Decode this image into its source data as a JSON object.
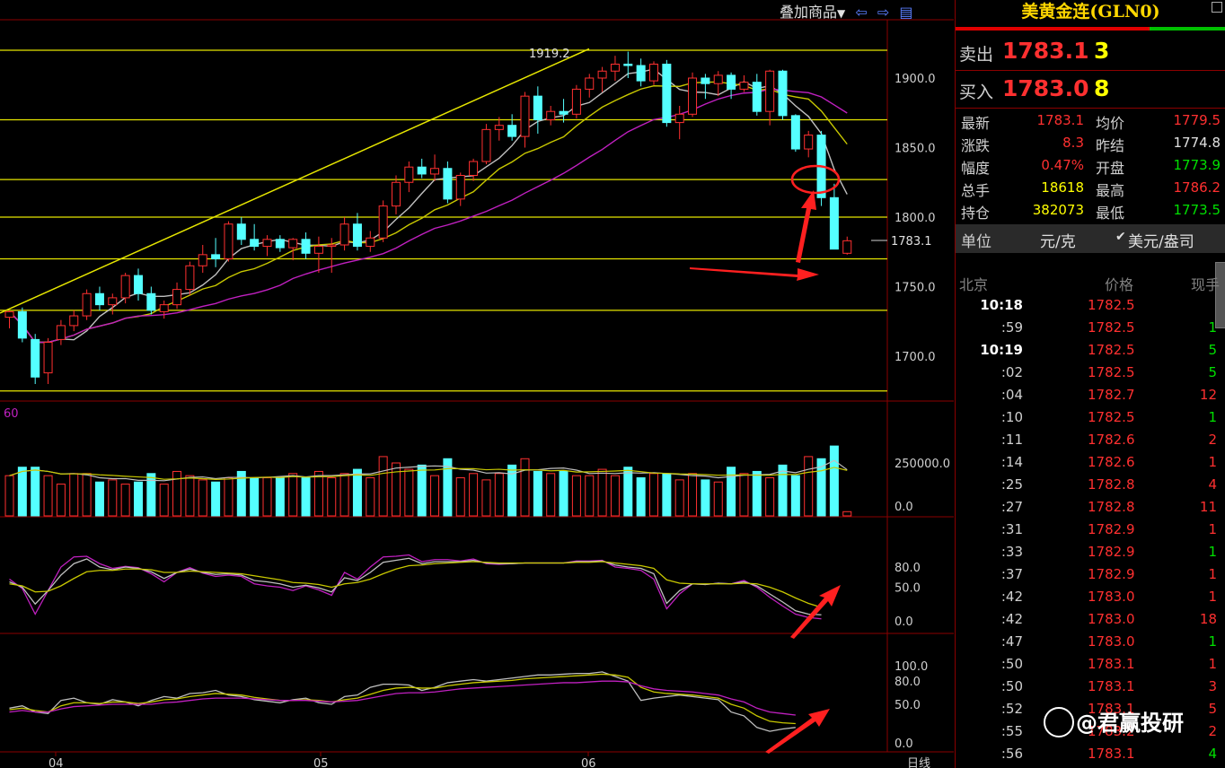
{
  "toolbar": {
    "overlay_label": "叠加商品",
    "dropdown_icon": "caret-down-icon",
    "prev_icon": "arrow-left-icon",
    "next_icon": "arrow-right-icon",
    "layout_icon": "layout-icon"
  },
  "panel": {
    "title": "美黄金连(GLN0)",
    "sell": {
      "label": "卖出",
      "price": "1783.1",
      "volume": "3"
    },
    "buy": {
      "label": "买入",
      "price": "1783.0",
      "volume": "8"
    },
    "stats": [
      {
        "k1": "最新",
        "v1": "1783.1",
        "c1": "#ff3030",
        "k2": "均价",
        "v2": "1779.5",
        "c2": "#ff3030"
      },
      {
        "k1": "涨跌",
        "v1": "8.3",
        "c1": "#ff3030",
        "k2": "昨结",
        "v2": "1774.8",
        "c2": "#e0e0e0"
      },
      {
        "k1": "幅度",
        "v1": "0.47%",
        "c1": "#ff3030",
        "k2": "开盘",
        "v2": "1773.9",
        "c2": "#00e000"
      },
      {
        "k1": "总手",
        "v1": "18618",
        "c1": "#ffff00",
        "k2": "最高",
        "v2": "1786.2",
        "c2": "#ff3030"
      },
      {
        "k1": "持仓",
        "v1": "382073",
        "c1": "#ffff00",
        "k2": "最低",
        "v2": "1773.5",
        "c2": "#00e000"
      }
    ],
    "unit_label": "单位",
    "unit_option1": "元/克",
    "unit_option2": "美元/盎司",
    "ticks_header": {
      "c1": "北京",
      "c2": "价格",
      "c3": "现手"
    },
    "ticks": [
      {
        "t": "10:18",
        "bold": true,
        "p": "1782.5",
        "v": "",
        "vc": "#00e000"
      },
      {
        "t": ":59",
        "bold": false,
        "p": "1782.5",
        "v": "1",
        "vc": "#00e000"
      },
      {
        "t": "10:19",
        "bold": true,
        "p": "1782.5",
        "v": "5",
        "vc": "#00e000"
      },
      {
        "t": ":02",
        "bold": false,
        "p": "1782.5",
        "v": "5",
        "vc": "#00e000"
      },
      {
        "t": ":04",
        "bold": false,
        "p": "1782.7",
        "v": "12",
        "vc": "#ff3030"
      },
      {
        "t": ":10",
        "bold": false,
        "p": "1782.5",
        "v": "1",
        "vc": "#00e000"
      },
      {
        "t": ":11",
        "bold": false,
        "p": "1782.6",
        "v": "2",
        "vc": "#ff3030"
      },
      {
        "t": ":14",
        "bold": false,
        "p": "1782.6",
        "v": "1",
        "vc": "#ff3030"
      },
      {
        "t": ":25",
        "bold": false,
        "p": "1782.8",
        "v": "4",
        "vc": "#ff3030"
      },
      {
        "t": ":27",
        "bold": false,
        "p": "1782.8",
        "v": "11",
        "vc": "#ff3030"
      },
      {
        "t": ":31",
        "bold": false,
        "p": "1782.9",
        "v": "1",
        "vc": "#ff3030"
      },
      {
        "t": ":33",
        "bold": false,
        "p": "1782.9",
        "v": "1",
        "vc": "#00e000"
      },
      {
        "t": ":37",
        "bold": false,
        "p": "1782.9",
        "v": "1",
        "vc": "#ff3030"
      },
      {
        "t": ":42",
        "bold": false,
        "p": "1783.0",
        "v": "1",
        "vc": "#ff3030"
      },
      {
        "t": ":42",
        "bold": false,
        "p": "1783.0",
        "v": "18",
        "vc": "#ff3030"
      },
      {
        "t": ":47",
        "bold": false,
        "p": "1783.0",
        "v": "1",
        "vc": "#00e000"
      },
      {
        "t": ":50",
        "bold": false,
        "p": "1783.1",
        "v": "1",
        "vc": "#ff3030"
      },
      {
        "t": ":50",
        "bold": false,
        "p": "1783.1",
        "v": "3",
        "vc": "#ff3030"
      },
      {
        "t": ":52",
        "bold": false,
        "p": "1783.1",
        "v": "5",
        "vc": "#ff3030"
      },
      {
        "t": ":55",
        "bold": false,
        "p": "1783.2",
        "v": "2",
        "vc": "#ff3030"
      },
      {
        "t": ":56",
        "bold": false,
        "p": "1783.1",
        "v": "4",
        "vc": "#00e000"
      }
    ]
  },
  "watermark": "@君赢投研",
  "chart": {
    "peak_label": "1919.2",
    "last_price_label": "1783.1",
    "price_axis": [
      "1900.0",
      "1850.0",
      "1800.0",
      "1750.0",
      "1700.0"
    ],
    "volume_axis": [
      "250000.0",
      "0.0"
    ],
    "volume_tag": "60",
    "ind1_axis": [
      "80.0",
      "50.0",
      "0.0"
    ],
    "ind2_axis": [
      "100.0",
      "80.0",
      "50.0",
      "0.0"
    ],
    "months": [
      "04",
      "05",
      "06"
    ],
    "period": "日线",
    "colors": {
      "up": "#ff3030",
      "down": "#54ffff",
      "ma1": "#c0c0c0",
      "ma2": "#c8c800",
      "ma3": "#c020c0",
      "hline": "#e6e600"
    }
  },
  "chart_data": {
    "type": "candlestick",
    "horizontal_levels": [
      1920,
      1870,
      1827,
      1800,
      1770,
      1733,
      1675
    ],
    "candles": [
      [
        1728,
        1733,
        1720,
        1732
      ],
      [
        1732,
        1735,
        1710,
        1713
      ],
      [
        1712,
        1716,
        1680,
        1685
      ],
      [
        1688,
        1713,
        1680,
        1710
      ],
      [
        1712,
        1726,
        1708,
        1722
      ],
      [
        1722,
        1733,
        1718,
        1729
      ],
      [
        1729,
        1748,
        1726,
        1745
      ],
      [
        1745,
        1750,
        1733,
        1737
      ],
      [
        1737,
        1745,
        1730,
        1742
      ],
      [
        1742,
        1760,
        1738,
        1758
      ],
      [
        1758,
        1763,
        1740,
        1745
      ],
      [
        1745,
        1750,
        1730,
        1733
      ],
      [
        1732,
        1740,
        1727,
        1737
      ],
      [
        1737,
        1753,
        1734,
        1748
      ],
      [
        1748,
        1768,
        1744,
        1765
      ],
      [
        1765,
        1780,
        1760,
        1773
      ],
      [
        1773,
        1785,
        1764,
        1770
      ],
      [
        1770,
        1797,
        1768,
        1795
      ],
      [
        1795,
        1800,
        1780,
        1784
      ],
      [
        1784,
        1795,
        1776,
        1779
      ],
      [
        1779,
        1787,
        1772,
        1784
      ],
      [
        1784,
        1787,
        1775,
        1778
      ],
      [
        1778,
        1785,
        1769,
        1784
      ],
      [
        1784,
        1789,
        1770,
        1774
      ],
      [
        1774,
        1786,
        1760,
        1779
      ],
      [
        1779,
        1785,
        1760,
        1780
      ],
      [
        1780,
        1800,
        1776,
        1795
      ],
      [
        1795,
        1803,
        1776,
        1779
      ],
      [
        1779,
        1790,
        1775,
        1785
      ],
      [
        1785,
        1812,
        1782,
        1808
      ],
      [
        1808,
        1830,
        1802,
        1825
      ],
      [
        1825,
        1840,
        1818,
        1836
      ],
      [
        1836,
        1842,
        1828,
        1831
      ],
      [
        1831,
        1845,
        1826,
        1835
      ],
      [
        1835,
        1840,
        1810,
        1813
      ],
      [
        1813,
        1832,
        1808,
        1830
      ],
      [
        1830,
        1842,
        1826,
        1840
      ],
      [
        1840,
        1867,
        1838,
        1863
      ],
      [
        1863,
        1872,
        1855,
        1866
      ],
      [
        1866,
        1874,
        1855,
        1858
      ],
      [
        1858,
        1890,
        1850,
        1887
      ],
      [
        1887,
        1894,
        1860,
        1870
      ],
      [
        1870,
        1880,
        1866,
        1876
      ],
      [
        1876,
        1885,
        1868,
        1874
      ],
      [
        1874,
        1895,
        1871,
        1892
      ],
      [
        1892,
        1903,
        1886,
        1900
      ],
      [
        1900,
        1908,
        1890,
        1905
      ],
      [
        1905,
        1916,
        1898,
        1910
      ],
      [
        1910,
        1919,
        1900,
        1909
      ],
      [
        1909,
        1914,
        1894,
        1898
      ],
      [
        1898,
        1912,
        1895,
        1910
      ],
      [
        1910,
        1913,
        1865,
        1868
      ],
      [
        1868,
        1880,
        1856,
        1874
      ],
      [
        1874,
        1904,
        1872,
        1900
      ],
      [
        1900,
        1903,
        1885,
        1896
      ],
      [
        1896,
        1905,
        1887,
        1902
      ],
      [
        1902,
        1904,
        1885,
        1892
      ],
      [
        1892,
        1902,
        1890,
        1897
      ],
      [
        1897,
        1903,
        1873,
        1876
      ],
      [
        1876,
        1906,
        1866,
        1905
      ],
      [
        1905,
        1906,
        1870,
        1873
      ],
      [
        1873,
        1874,
        1847,
        1849
      ],
      [
        1849,
        1862,
        1843,
        1859
      ],
      [
        1859,
        1862,
        1808,
        1814
      ],
      [
        1814,
        1824,
        1777,
        1777
      ],
      [
        1774,
        1786,
        1773,
        1783
      ]
    ],
    "volume": [
      190,
      230,
      230,
      190,
      150,
      200,
      200,
      160,
      170,
      150,
      160,
      200,
      150,
      210,
      190,
      170,
      160,
      180,
      210,
      180,
      180,
      180,
      200,
      180,
      210,
      180,
      200,
      220,
      180,
      280,
      250,
      220,
      240,
      190,
      270,
      180,
      200,
      170,
      200,
      240,
      270,
      210,
      200,
      210,
      190,
      190,
      220,
      190,
      230,
      180,
      200,
      200,
      170,
      200,
      170,
      160,
      230,
      200,
      210,
      180,
      240,
      190,
      280,
      270,
      330,
      20
    ],
    "ind1_k": [
      58,
      50,
      25,
      45,
      68,
      85,
      92,
      80,
      76,
      80,
      78,
      73,
      63,
      72,
      77,
      72,
      69,
      70,
      68,
      60,
      58,
      55,
      50,
      53,
      49,
      43,
      64,
      60,
      72,
      87,
      90,
      93,
      85,
      88,
      88,
      88,
      90,
      86,
      85,
      85,
      86,
      86,
      86,
      86,
      88,
      88,
      89,
      83,
      80,
      78,
      70,
      26,
      45,
      55,
      54,
      56,
      55,
      58,
      52,
      40,
      28,
      15,
      10,
      9
    ],
    "ind1_d": [
      55,
      52,
      43,
      44,
      52,
      63,
      73,
      75,
      75,
      77,
      77,
      76,
      72,
      72,
      74,
      73,
      72,
      71,
      70,
      67,
      64,
      61,
      57,
      56,
      54,
      50,
      55,
      57,
      62,
      70,
      77,
      82,
      83,
      85,
      86,
      87,
      88,
      87,
      86,
      86,
      86,
      86,
      86,
      86,
      87,
      87,
      88,
      86,
      84,
      82,
      78,
      61,
      56,
      55,
      55,
      55,
      55,
      56,
      55,
      50,
      43,
      34,
      26,
      20
    ],
    "ind1_j": [
      62,
      48,
      10,
      45,
      80,
      95,
      96,
      85,
      78,
      81,
      79,
      70,
      58,
      72,
      79,
      71,
      66,
      68,
      66,
      55,
      52,
      50,
      45,
      52,
      46,
      38,
      72,
      62,
      80,
      95,
      96,
      98,
      88,
      91,
      91,
      89,
      92,
      85,
      84,
      85,
      86,
      86,
      86,
      86,
      89,
      89,
      90,
      80,
      78,
      75,
      62,
      18,
      40,
      55,
      54,
      56,
      55,
      60,
      50,
      35,
      22,
      10,
      5,
      3
    ],
    "ind2_a": [
      45,
      48,
      40,
      38,
      55,
      58,
      52,
      50,
      56,
      53,
      48,
      55,
      60,
      58,
      64,
      65,
      68,
      62,
      60,
      56,
      54,
      52,
      56,
      58,
      52,
      50,
      60,
      62,
      72,
      76,
      76,
      75,
      68,
      72,
      78,
      80,
      82,
      80,
      82,
      84,
      86,
      88,
      88,
      89,
      90,
      90,
      92,
      86,
      80,
      55,
      58,
      60,
      62,
      60,
      58,
      56,
      40,
      35,
      20,
      15,
      18,
      20
    ],
    "ind2_b": [
      43,
      45,
      42,
      40,
      48,
      52,
      52,
      51,
      53,
      53,
      51,
      53,
      56,
      57,
      60,
      62,
      64,
      63,
      62,
      59,
      57,
      55,
      55,
      56,
      55,
      53,
      56,
      58,
      63,
      68,
      71,
      72,
      71,
      71,
      74,
      76,
      78,
      79,
      80,
      81,
      83,
      84,
      85,
      86,
      87,
      88,
      89,
      88,
      85,
      72,
      66,
      64,
      63,
      62,
      60,
      58,
      50,
      45,
      35,
      28,
      26,
      25
    ],
    "ind2_c": [
      40,
      42,
      40,
      40,
      44,
      47,
      48,
      49,
      50,
      50,
      50,
      50,
      52,
      53,
      55,
      57,
      58,
      58,
      58,
      57,
      56,
      55,
      55,
      55,
      54,
      53,
      54,
      55,
      58,
      61,
      64,
      65,
      65,
      66,
      68,
      70,
      71,
      72,
      73,
      74,
      75,
      76,
      77,
      78,
      78,
      79,
      80,
      80,
      79,
      74,
      70,
      68,
      67,
      66,
      64,
      62,
      57,
      53,
      45,
      40,
      38,
      36
    ]
  }
}
